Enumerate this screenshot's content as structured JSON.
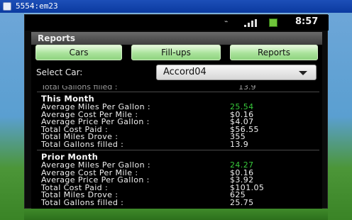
{
  "window": {
    "title": "5554:em23"
  },
  "statusbar": {
    "time": "8:57",
    "usb_icon": "usb-icon",
    "signal_icon": "signal-icon",
    "battery_icon": "battery-icon"
  },
  "app": {
    "title": "Reports"
  },
  "tabs": [
    {
      "label": "Cars"
    },
    {
      "label": "Fill-ups"
    },
    {
      "label": "Reports"
    }
  ],
  "select": {
    "label": "Select Car:",
    "value": "Accord04"
  },
  "clipped": {
    "label": "Total Gallons filled :",
    "value": "13.9"
  },
  "sections": [
    {
      "title": "This Month",
      "rows": [
        {
          "label": "Average Miles Per Gallon :",
          "value": "25.54",
          "highlight": true
        },
        {
          "label": "Average Cost Per Mile :",
          "value": "$0.16",
          "highlight": false
        },
        {
          "label": "Average Price Per Gallon :",
          "value": "$4.07",
          "highlight": false
        },
        {
          "label": "Total Cost Paid :",
          "value": "$56.55",
          "highlight": false
        },
        {
          "label": "Total Miles Drove :",
          "value": "355",
          "highlight": false
        },
        {
          "label": "Total Gallons filled :",
          "value": "13.9",
          "highlight": false
        }
      ]
    },
    {
      "title": "Prior Month",
      "rows": [
        {
          "label": "Average Miles Per Gallon :",
          "value": "24.27",
          "highlight": true
        },
        {
          "label": "Average Cost Per Mile :",
          "value": "$0.16",
          "highlight": false
        },
        {
          "label": "Average Price Per Gallon :",
          "value": "$3.92",
          "highlight": false
        },
        {
          "label": "Total Cost Paid :",
          "value": "$101.05",
          "highlight": false
        },
        {
          "label": "Total Miles Drove :",
          "value": "625",
          "highlight": false
        },
        {
          "label": "Total Gallons filled :",
          "value": "25.75",
          "highlight": false
        }
      ]
    }
  ],
  "colors": {
    "highlight_value": "#37c83a",
    "tab_green": "#a9e39b"
  }
}
